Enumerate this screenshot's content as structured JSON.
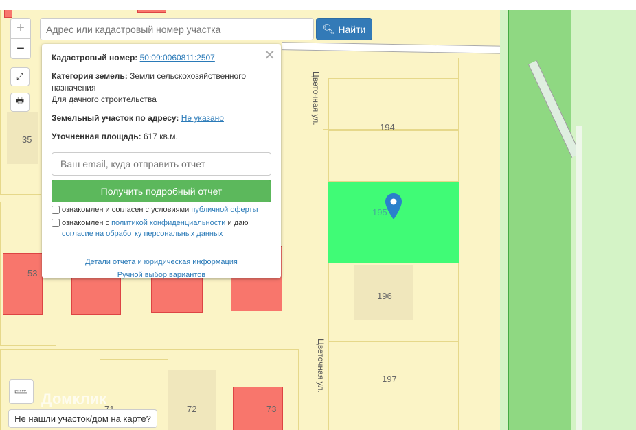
{
  "search": {
    "placeholder": "Адрес или кадастровый номер участка",
    "button": "Найти"
  },
  "controls": {
    "zoom_in": "+",
    "zoom_out": "−"
  },
  "popup": {
    "cadastral_label": "Кадастровый номер:",
    "cadastral_value": "50:09:0060811:2507",
    "category_label": "Категория земель:",
    "category_value": "Земли сельскохозяйственного назначения",
    "usage": "Для дачного строительства",
    "address_label": "Земельный участок по адресу:",
    "address_value": "Не указано",
    "area_label": "Уточненная площадь:",
    "area_value": "617 кв.м.",
    "email_placeholder": "Ваш email, куда отправить отчет",
    "get_report": "Получить подробный отчет",
    "agree1_text": "ознакомлен и согласен с условиями ",
    "agree1_link": "публичной оферты",
    "agree2_text": "ознакомлен с ",
    "agree2_link": "политикой конфиденциальности",
    "agree2_mid": " и даю ",
    "agree2_link2": "согласие на обработку персональных данных",
    "details_link": "Детали отчета и юридическая информация",
    "manual_link": "Ручной выбор вариантов"
  },
  "map": {
    "labels": {
      "p35": "35",
      "p53": "53",
      "p194": "194",
      "p195": "195",
      "p196": "196",
      "p197": "197",
      "p71": "71",
      "p72": "72",
      "p73": "73"
    },
    "street": "Цветочная ул.",
    "watermark": "Домклик",
    "colors": {
      "selected": "#40fb76",
      "forest": "#8fd882",
      "meadow": "#d4f3c6"
    }
  },
  "not_found_button": "Не нашли участок/дом на карте?"
}
